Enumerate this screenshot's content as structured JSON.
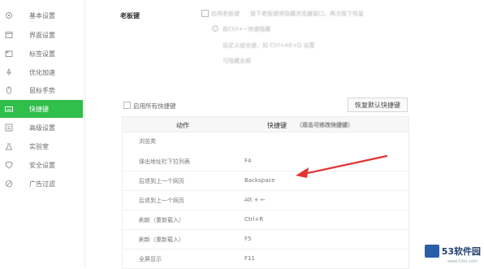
{
  "sidebar": {
    "items": [
      {
        "label": "基本设置",
        "icon": "gear-icon",
        "active": false
      },
      {
        "label": "界面设置",
        "icon": "window-icon",
        "active": false
      },
      {
        "label": "标签设置",
        "icon": "tab-icon",
        "active": false
      },
      {
        "label": "优化加速",
        "icon": "rocket-icon",
        "active": false
      },
      {
        "label": "鼠标手势",
        "icon": "mouse-icon",
        "active": false
      },
      {
        "label": "快捷键",
        "icon": "keyboard-icon",
        "active": true
      },
      {
        "label": "高级设置",
        "icon": "advanced-icon",
        "active": false
      },
      {
        "label": "实验室",
        "icon": "flask-icon",
        "active": false
      },
      {
        "label": "安全设置",
        "icon": "shield-icon",
        "active": false
      },
      {
        "label": "广告过滤",
        "icon": "filter-icon",
        "active": false
      }
    ]
  },
  "boss_key": {
    "title": "老板键",
    "enable_label": "启用老板键",
    "description": "按下老板键将隐藏浏览器窗口，再次按下恢复",
    "option1": "按Ctrl+~快速隐藏",
    "option2_line": "自定义组合键，如 Ctrl+Alt+Q 设置",
    "sub_line": "可隐藏全部"
  },
  "shortcuts": {
    "enable_all_label": "启用所有快捷键",
    "reset_button": "恢复默认快捷键",
    "col_action": "动作",
    "col_key": "快捷键",
    "col_key_hint": "（双击可修改快捷键）",
    "group": "浏览类",
    "rows": [
      {
        "action": "弹出地址栏下拉列表",
        "key": "F4"
      },
      {
        "action": "后退到上一个网页",
        "key": "Backspace"
      },
      {
        "action": "后退到上一个网页",
        "key": "Alt + ←"
      },
      {
        "action": "刷新（重新载入）",
        "key": "Ctrl+R"
      },
      {
        "action": "刷新（重新载入）",
        "key": "F5"
      },
      {
        "action": "全屏显示",
        "key": "F11"
      }
    ]
  },
  "watermark": {
    "brand": "53软件园",
    "site": "www.53xt.com"
  },
  "colors": {
    "accent": "#2fbf4a",
    "arrow": "#e03434"
  }
}
